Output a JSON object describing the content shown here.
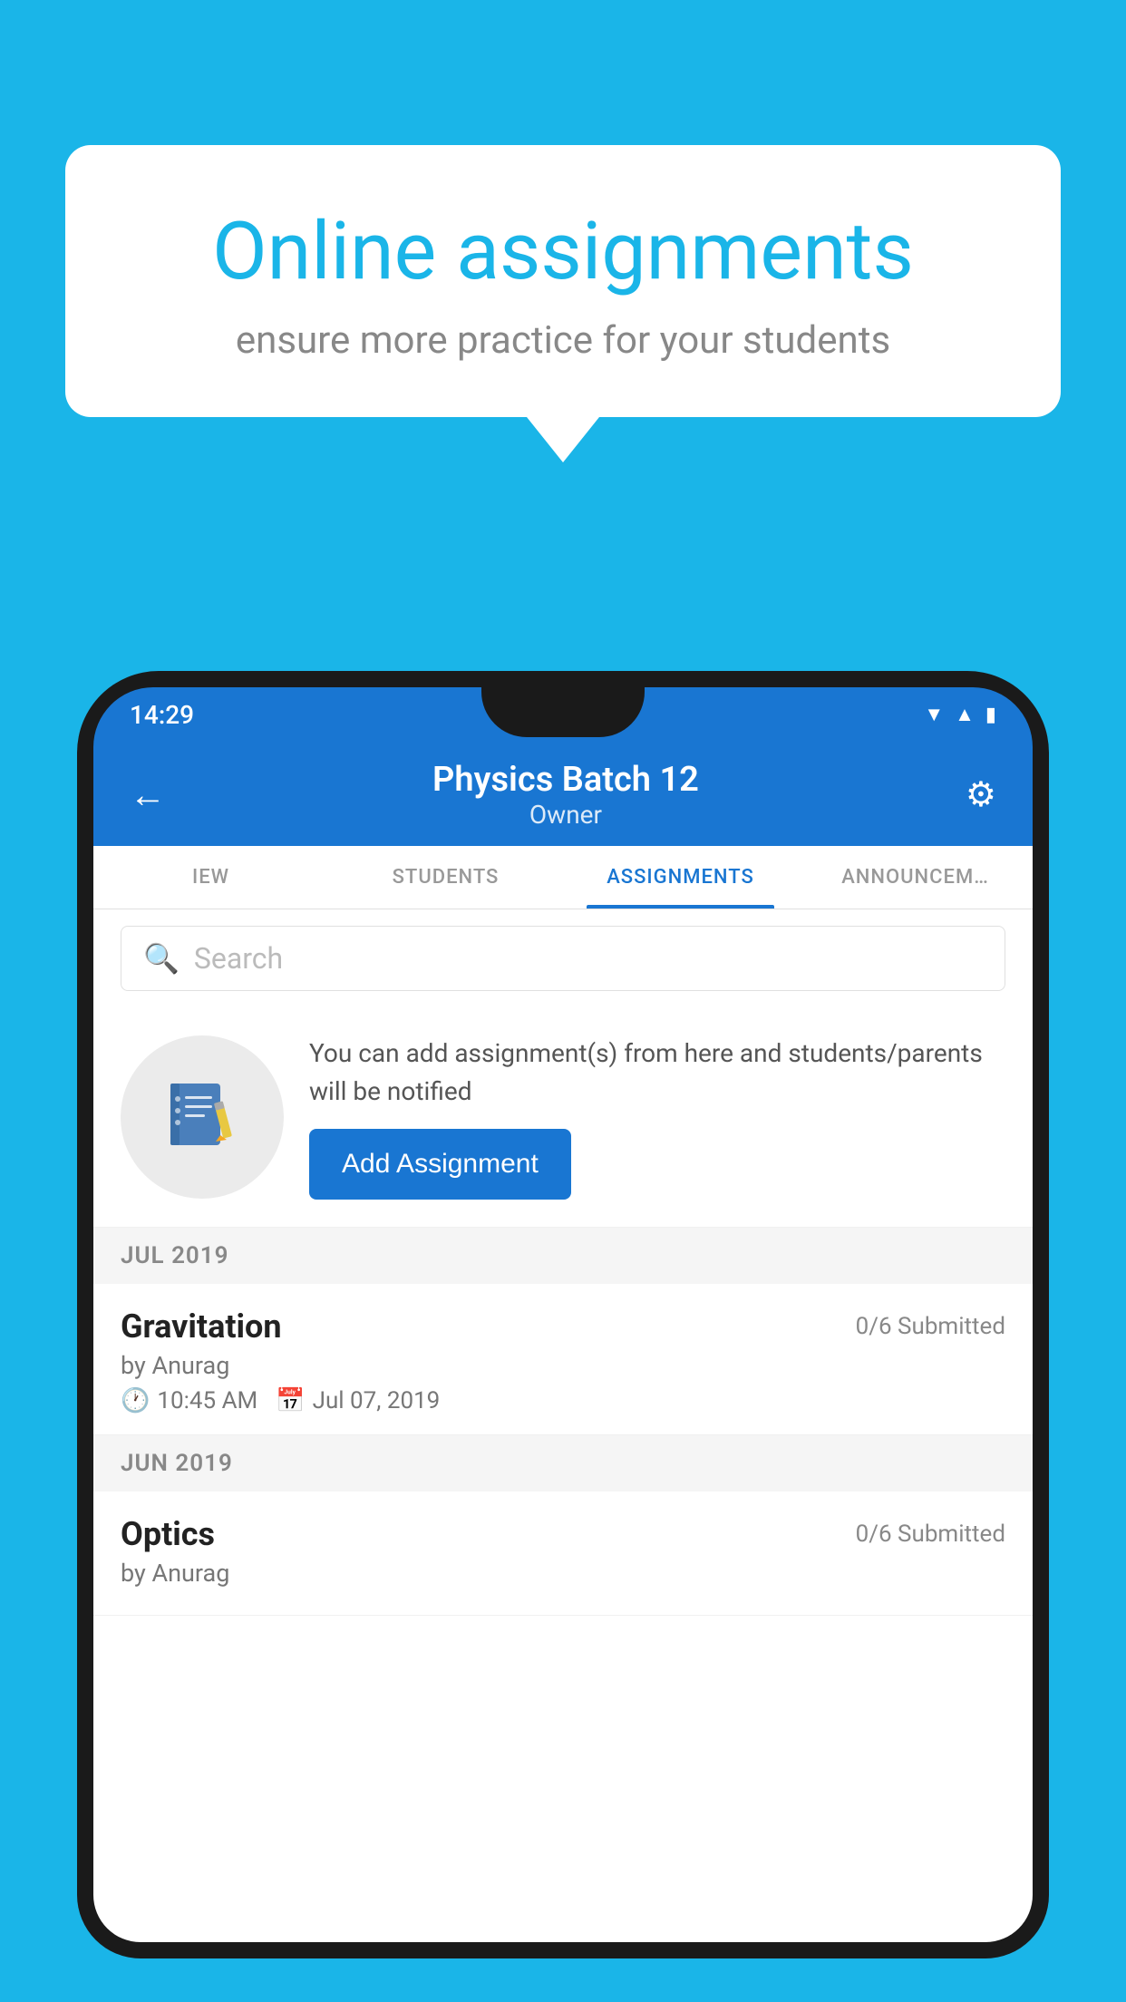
{
  "background_color": "#1ab5e8",
  "speech_bubble": {
    "title": "Online assignments",
    "subtitle": "ensure more practice for your students"
  },
  "phone": {
    "status_bar": {
      "time": "14:29"
    },
    "header": {
      "title": "Physics Batch 12",
      "subtitle": "Owner",
      "back_label": "←",
      "settings_label": "⚙"
    },
    "tabs": [
      {
        "label": "IEW",
        "active": false
      },
      {
        "label": "STUDENTS",
        "active": false
      },
      {
        "label": "ASSIGNMENTS",
        "active": true
      },
      {
        "label": "ANNOUNCEM…",
        "active": false
      }
    ],
    "search": {
      "placeholder": "Search"
    },
    "info_box": {
      "text": "You can add assignment(s) from here and students/parents will be notified",
      "button_label": "Add Assignment"
    },
    "sections": [
      {
        "label": "JUL 2019",
        "assignments": [
          {
            "title": "Gravitation",
            "submitted": "0/6 Submitted",
            "by": "by Anurag",
            "time": "10:45 AM",
            "date": "Jul 07, 2019"
          }
        ]
      },
      {
        "label": "JUN 2019",
        "assignments": [
          {
            "title": "Optics",
            "submitted": "0/6 Submitted",
            "by": "by Anurag",
            "time": "",
            "date": ""
          }
        ]
      }
    ]
  }
}
